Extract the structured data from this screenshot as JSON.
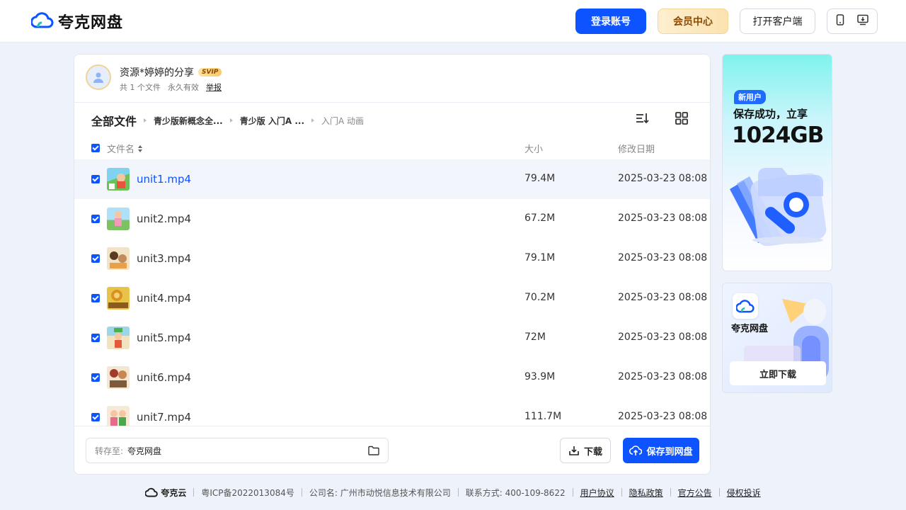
{
  "header": {
    "logo_text": "夸克网盘",
    "login_label": "登录账号",
    "vip_label": "会员中心",
    "client_label": "打开客户端"
  },
  "share": {
    "title": "资源*婷婷的分享",
    "badge": "SVIP",
    "file_count": "共 1 个文件",
    "validity": "永久有效",
    "report": "举报"
  },
  "breadcrumb": {
    "root": "全部文件",
    "items": [
      "青少版新概念全...",
      "青少版 入门A ...",
      "入门A 动画"
    ]
  },
  "table": {
    "col_name": "文件名",
    "col_size": "大小",
    "col_date": "修改日期",
    "rows": [
      {
        "name": "unit1.mp4",
        "size": "79.4M",
        "date": "2025-03-23 08:08"
      },
      {
        "name": "unit2.mp4",
        "size": "67.2M",
        "date": "2025-03-23 08:08"
      },
      {
        "name": "unit3.mp4",
        "size": "79.1M",
        "date": "2025-03-23 08:08"
      },
      {
        "name": "unit4.mp4",
        "size": "70.2M",
        "date": "2025-03-23 08:08"
      },
      {
        "name": "unit5.mp4",
        "size": "72M",
        "date": "2025-03-23 08:08"
      },
      {
        "name": "unit6.mp4",
        "size": "93.9M",
        "date": "2025-03-23 08:08"
      },
      {
        "name": "unit7.mp4",
        "size": "111.7M",
        "date": "2025-03-23 08:08"
      }
    ]
  },
  "footer_bar": {
    "save_to_label": "转存至:",
    "save_to_value": "夸克网盘",
    "download_label": "下载",
    "save_label": "保存到网盘"
  },
  "ad1": {
    "badge": "新用户",
    "line1": "保存成功，立享",
    "line2": "1024GB"
  },
  "ad2": {
    "name": "夸克网盘",
    "button": "立即下载"
  },
  "site_footer": {
    "brand": "夸克云",
    "icp": "粤ICP备2022013084号",
    "company": "公司名: 广州市动悦信息技术有限公司",
    "contact": "联系方式: 400-109-8622",
    "links": [
      "用户协议",
      "隐私政策",
      "官方公告",
      "侵权投诉"
    ]
  },
  "colors": {
    "accent": "#0d53ff",
    "background": "#eef2fb"
  }
}
